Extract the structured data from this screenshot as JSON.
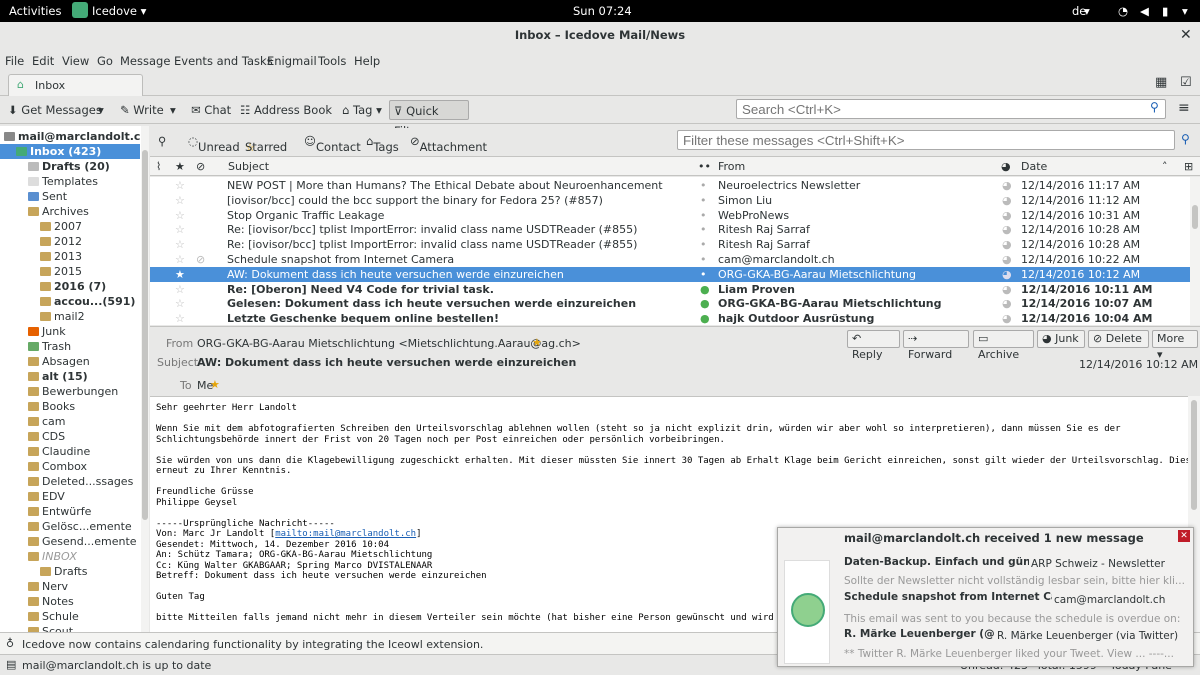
{
  "topbar": {
    "activities": "Activities",
    "app": "Icedove",
    "clock": "Sun 07:24",
    "lang": "de"
  },
  "window": {
    "title": "Inbox – Icedove Mail/News"
  },
  "menu": [
    "File",
    "Edit",
    "View",
    "Go",
    "Message",
    "Events and Tasks",
    "Enigmail",
    "Tools",
    "Help"
  ],
  "tab": {
    "label": "Inbox"
  },
  "toolbar": {
    "get_messages": "Get Messages",
    "write": "Write",
    "chat": "Chat",
    "address_book": "Address Book",
    "tag": "Tag",
    "quick_filter": "Quick Filter",
    "search_placeholder": "Search <Ctrl+K>"
  },
  "folders": [
    {
      "label": "mail@marclandolt.ch",
      "indent": 0,
      "bold": true,
      "sel": false,
      "icon": "account"
    },
    {
      "label": "Inbox (423)",
      "indent": 1,
      "bold": true,
      "sel": true,
      "icon": "inbox"
    },
    {
      "label": "Drafts (20)",
      "indent": 2,
      "bold": true,
      "sel": false,
      "icon": "drafts"
    },
    {
      "label": "Templates",
      "indent": 2,
      "bold": false,
      "sel": false,
      "icon": "templates"
    },
    {
      "label": "Sent",
      "indent": 2,
      "bold": false,
      "sel": false,
      "icon": "sent"
    },
    {
      "label": "Archives",
      "indent": 2,
      "bold": false,
      "sel": false,
      "icon": "archives"
    },
    {
      "label": "2007",
      "indent": 3,
      "bold": false,
      "sel": false,
      "icon": "folder"
    },
    {
      "label": "2012",
      "indent": 3,
      "bold": false,
      "sel": false,
      "icon": "folder"
    },
    {
      "label": "2013",
      "indent": 3,
      "bold": false,
      "sel": false,
      "icon": "folder"
    },
    {
      "label": "2015",
      "indent": 3,
      "bold": false,
      "sel": false,
      "icon": "folder"
    },
    {
      "label": "2016 (7)",
      "indent": 3,
      "bold": true,
      "sel": false,
      "icon": "folder"
    },
    {
      "label": "accou...(591)",
      "indent": 3,
      "bold": true,
      "sel": false,
      "icon": "folder"
    },
    {
      "label": "mail2",
      "indent": 3,
      "bold": false,
      "sel": false,
      "icon": "folder"
    },
    {
      "label": "Junk",
      "indent": 2,
      "bold": false,
      "sel": false,
      "icon": "junk"
    },
    {
      "label": "Trash",
      "indent": 2,
      "bold": false,
      "sel": false,
      "icon": "trash"
    },
    {
      "label": "Absagen",
      "indent": 2,
      "bold": false,
      "sel": false,
      "icon": "folder"
    },
    {
      "label": "alt (15)",
      "indent": 2,
      "bold": true,
      "sel": false,
      "icon": "folder"
    },
    {
      "label": "Bewerbungen",
      "indent": 2,
      "bold": false,
      "sel": false,
      "icon": "folder"
    },
    {
      "label": "Books",
      "indent": 2,
      "bold": false,
      "sel": false,
      "icon": "folder"
    },
    {
      "label": "cam",
      "indent": 2,
      "bold": false,
      "sel": false,
      "icon": "folder"
    },
    {
      "label": "CDS",
      "indent": 2,
      "bold": false,
      "sel": false,
      "icon": "folder"
    },
    {
      "label": "Claudine",
      "indent": 2,
      "bold": false,
      "sel": false,
      "icon": "folder"
    },
    {
      "label": "Combox",
      "indent": 2,
      "bold": false,
      "sel": false,
      "icon": "folder"
    },
    {
      "label": "Deleted...ssages",
      "indent": 2,
      "bold": false,
      "sel": false,
      "icon": "folder"
    },
    {
      "label": "EDV",
      "indent": 2,
      "bold": false,
      "sel": false,
      "icon": "folder"
    },
    {
      "label": "Entwürfe",
      "indent": 2,
      "bold": false,
      "sel": false,
      "icon": "folder"
    },
    {
      "label": "Gelösc...emente",
      "indent": 2,
      "bold": false,
      "sel": false,
      "icon": "folder"
    },
    {
      "label": "Gesend...emente",
      "indent": 2,
      "bold": false,
      "sel": false,
      "icon": "folder"
    },
    {
      "label": "INBOX",
      "indent": 2,
      "bold": false,
      "sel": false,
      "icon": "folder",
      "italic": true
    },
    {
      "label": "Drafts",
      "indent": 3,
      "bold": false,
      "sel": false,
      "icon": "folder"
    },
    {
      "label": "Nerv",
      "indent": 2,
      "bold": false,
      "sel": false,
      "icon": "folder"
    },
    {
      "label": "Notes",
      "indent": 2,
      "bold": false,
      "sel": false,
      "icon": "folder"
    },
    {
      "label": "Schule",
      "indent": 2,
      "bold": false,
      "sel": false,
      "icon": "folder"
    },
    {
      "label": "Scout",
      "indent": 2,
      "bold": false,
      "sel": false,
      "icon": "folder"
    }
  ],
  "quickfilter": {
    "unread": "Unread",
    "starred": "Starred",
    "contact": "Contact",
    "tags": "Tags",
    "attachment": "Attachment",
    "placeholder": "Filter these messages <Ctrl+Shift+K>"
  },
  "columns": {
    "subject": "Subject",
    "from": "From",
    "date": "Date"
  },
  "messages": [
    {
      "subject": "NEW POST | More than Humans? The Ethical Debate about Neuroenhancement",
      "from": "Neuroelectrics Newsletter",
      "date": "12/14/2016 11:17 AM",
      "unread": false,
      "sel": false,
      "att": false
    },
    {
      "subject": "[iovisor/bcc] could the bcc support the binary for Fedora 25? (#857)",
      "from": "Simon Liu",
      "date": "12/14/2016 11:12 AM",
      "unread": false,
      "sel": false,
      "att": false
    },
    {
      "subject": "Stop Organic Traffic Leakage",
      "from": "WebProNews",
      "date": "12/14/2016 10:31 AM",
      "unread": false,
      "sel": false,
      "att": false
    },
    {
      "subject": "Re: [iovisor/bcc] tplist ImportError: invalid class name USDTReader (#855)",
      "from": "Ritesh Raj Sarraf",
      "date": "12/14/2016 10:28 AM",
      "unread": false,
      "sel": false,
      "att": false
    },
    {
      "subject": "Re: [iovisor/bcc] tplist ImportError: invalid class name USDTReader (#855)",
      "from": "Ritesh Raj Sarraf",
      "date": "12/14/2016 10:28 AM",
      "unread": false,
      "sel": false,
      "att": false
    },
    {
      "subject": "Schedule snapshot from Internet Camera",
      "from": "cam@marclandolt.ch",
      "date": "12/14/2016 10:22 AM",
      "unread": false,
      "sel": false,
      "att": true
    },
    {
      "subject": "AW: Dokument dass ich heute versuchen werde einzureichen",
      "from": "ORG-GKA-BG-Aarau Mietschlichtung",
      "date": "12/14/2016 10:12 AM",
      "unread": false,
      "sel": true,
      "att": false
    },
    {
      "subject": "Re: [Oberon] Need V4 Code for trivial task.",
      "from": "Liam Proven",
      "date": "12/14/2016 10:11 AM",
      "unread": true,
      "sel": false,
      "att": false
    },
    {
      "subject": "Gelesen: Dokument dass ich heute versuchen werde einzureichen",
      "from": "ORG-GKA-BG-Aarau Mietschlichtung",
      "date": "12/14/2016 10:07 AM",
      "unread": true,
      "sel": false,
      "att": false
    },
    {
      "subject": "Letzte Geschenke bequem online bestellen!",
      "from": "hajk Outdoor Ausrüstung",
      "date": "12/14/2016 10:04 AM",
      "unread": true,
      "sel": false,
      "att": false
    }
  ],
  "header": {
    "from_label": "From",
    "from": "ORG-GKA-BG-Aarau Mietschlichtung <Mietschlichtung.Aarau@ag.ch>",
    "subject_label": "Subject",
    "subject": "AW: Dokument dass ich heute versuchen werde einzureichen",
    "to_label": "To",
    "to": "Me",
    "date": "12/14/2016 10:12 AM",
    "reply": "Reply",
    "forward": "Forward",
    "archive": "Archive",
    "junk": "Junk",
    "delete": "Delete",
    "more": "More"
  },
  "body": {
    "p1": "Sehr geehrter Herr Landolt",
    "p2": "Wenn Sie mit dem abfotografierten Schreiben den Urteilsvorschlag ablehnen wollen (steht so ja nicht explizit drin, würden wir aber wohl so interpretieren), dann müssen Sie es der\nSchlichtungsbehörde innert der Frist von 20 Tagen noch per Post einreichen oder persönlich vorbeibringen.",
    "p3": "Sie würden von uns dann die Klagebewilligung zugeschickt erhalten. Mit dieser müssten Sie innert 30 Tagen ab Erhalt Klage beim Gericht einreichen, sonst gilt wieder der Urteilsvorschlag. Dies\nerneut zu Ihrer Kenntnis.",
    "p4": "Freundliche Grüsse\nPhilippe Geysel",
    "p5a": "-----Ursprüngliche Nachricht-----\nVon: Marc Jr Landolt [",
    "p5link": "mailto:mail@marclandolt.ch",
    "p5b": "]\nGesendet: Mittwoch, 14. Dezember 2016 10:04\nAn: Schütz Tamara; ORG-GKA-BG-Aarau Mietschlichtung\nCc: Küng Walter GKABGAAR; Spring Marco DVISTALENAAR\nBetreff: Dokument dass ich heute versuchen werde einzureichen",
    "p6": "Guten Tag",
    "p7": "bitte Mitteilen falls jemand nicht mehr in diesem Verteiler sein möchte (hat bisher eine Person gewünscht und wird nic"
  },
  "notification_bar": "Icedove now contains calendaring functionality by integrating the Iceowl extension.",
  "status": {
    "text": "mail@marclandolt.ch is up to date",
    "unread": "Unread: 423",
    "total": "Total: 1599",
    "today": "Today Pane"
  },
  "popup": {
    "title": "mail@marclandolt.ch received 1 new message",
    "m1_subject": "Daten-Backup. Einfach und günstig.",
    "m1_from": "ARP Schweiz - Newsletter",
    "m1_preview": "Sollte der Newsletter nicht vollständig lesbar sein, bitte hier kli...",
    "m2_subject": "Schedule snapshot from Internet Camera",
    "m2_from": "cam@marclandolt.ch",
    "m2_preview": "This email was sent to you because the schedule is overdue on: ...",
    "m3_subject": "R. Märke Leuenberger (@R...",
    "m3_from": "R. Märke Leuenberger (via Twitter)",
    "m3_preview": "** Twitter R. Märke Leuenberger liked your Tweet. View ... ----..."
  },
  "colors": {
    "selection": "#4a90d9",
    "folder": "#c7a55a",
    "link": "#1a5fb4"
  }
}
